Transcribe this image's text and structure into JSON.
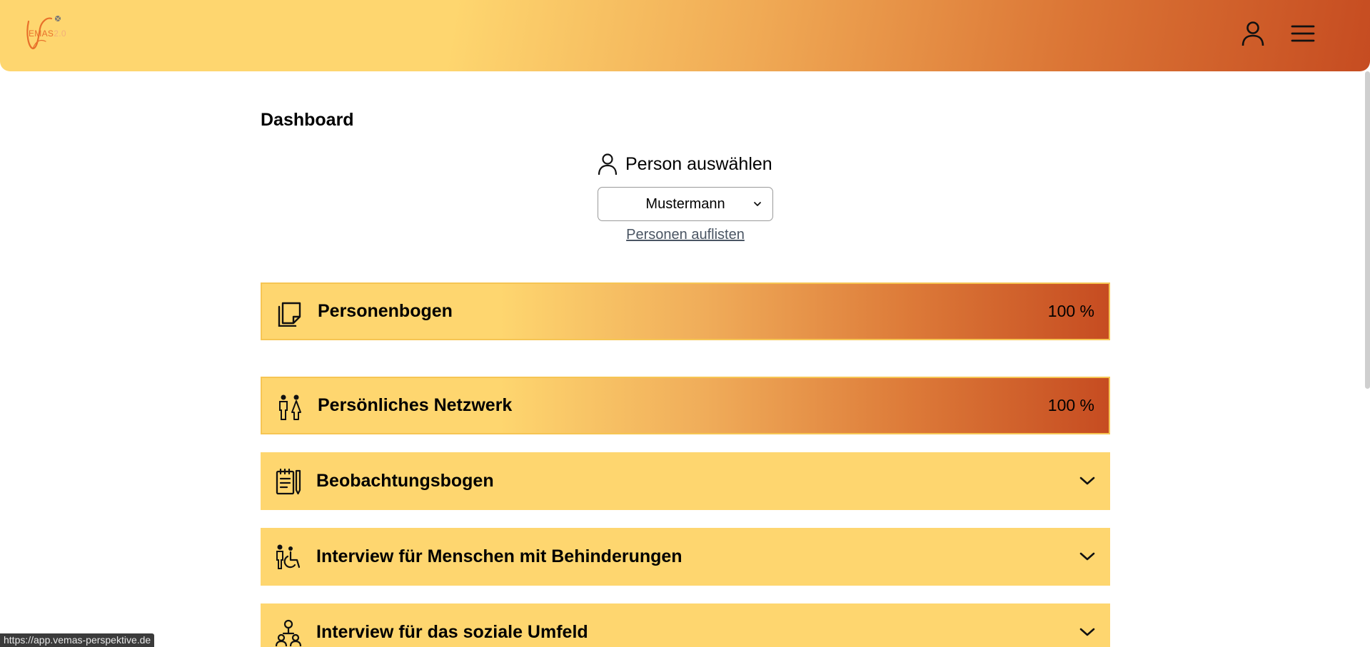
{
  "header": {
    "logo_text": "EMAS",
    "logo_version": "2.0",
    "icons": [
      "user-icon",
      "hamburger-menu-icon"
    ]
  },
  "page": {
    "title": "Dashboard"
  },
  "person": {
    "heading": "Person auswählen",
    "selected": "Mustermann",
    "list_link": "Personen auflisten"
  },
  "sections": [
    {
      "label": "Personenbogen",
      "value": "100 %",
      "icon": "notes-icon"
    },
    {
      "label": "Persönliches Netzwerk",
      "value": "100 %",
      "icon": "people-icon"
    },
    {
      "label": "Beobachtungsbogen",
      "icon": "notepad-icon"
    },
    {
      "label": "Interview für Menschen mit Behinderungen",
      "icon": "wheelchair-icon"
    },
    {
      "label": "Interview für das soziale Umfeld",
      "icon": "group-icon"
    }
  ],
  "status_bar": {
    "url": "https://app.vemas-perspektive.de"
  },
  "colors": {
    "header_start": "#fed66f",
    "header_end": "#c64c21",
    "section_bg": "#fed66f"
  }
}
